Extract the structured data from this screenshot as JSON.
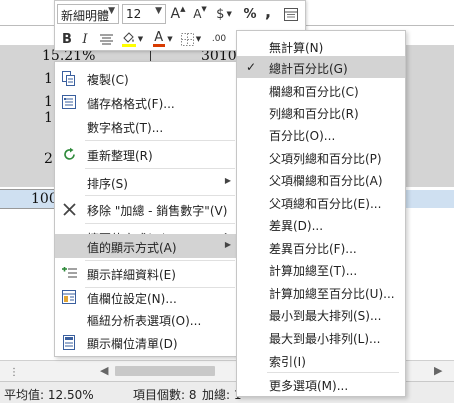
{
  "colors": {
    "accent_font_red": "#d83b01",
    "fill_yellow": "#ffff00",
    "cell_gray": "#d4d4d4",
    "cell_blue": "#cfe0f1",
    "menu_highlight": "#d3d3d3"
  },
  "toolbar": {
    "font_name": "新細明體",
    "font_size": "12",
    "grow_font": "A",
    "shrink_font": "A",
    "currency": "$",
    "percent": "%",
    "comma": ",",
    "bold": "B",
    "italic": "I",
    "fill_icon": "paint-bucket-icon",
    "font_color_letter": "A",
    "borders_icon": "borders-icon",
    "format_table_icon": "format-table-icon",
    "decrease_decimal_label": ".00"
  },
  "sheet": {
    "percent_value": "15.21%",
    "number_value": "3010",
    "left_fragments": [
      "1",
      "1",
      "1",
      "2"
    ],
    "blue_row_fragment": "100"
  },
  "context_menu": {
    "items": [
      {
        "icon": "copy-icon",
        "label": "複製(C)"
      },
      {
        "icon": "format-cells-icon",
        "label": "儲存格格式(F)..."
      },
      {
        "icon": "",
        "label": "數字格式(T)..."
      },
      {
        "icon": "refresh-icon",
        "label": "重新整理(R)"
      },
      {
        "icon": "",
        "label": "排序(S)"
      },
      {
        "icon": "remove-icon",
        "label": "移除 \"加總 - 銷售數字\"(V)"
      },
      {
        "icon": "",
        "label": "摘要值方式(M)"
      },
      {
        "icon": "",
        "label": "值的顯示方式(A)"
      },
      {
        "icon": "show-details-icon",
        "label": "顯示詳細資料(E)"
      },
      {
        "icon": "field-settings-icon",
        "label": "值欄位設定(N)..."
      },
      {
        "icon": "",
        "label": "樞紐分析表選項(O)..."
      },
      {
        "icon": "field-list-icon",
        "label": "顯示欄位清單(D)"
      }
    ]
  },
  "submenu": {
    "items": [
      "無計算(N)",
      "總計百分比(G)",
      "欄總和百分比(C)",
      "列總和百分比(R)",
      "百分比(O)...",
      "父項列總和百分比(P)",
      "父項欄總和百分比(A)",
      "父項總和百分比(E)...",
      "差異(D)...",
      "差異百分比(F)...",
      "計算加總至(T)...",
      "計算加總至百分比(U)...",
      "最小到最大排列(S)...",
      "最大到最小排列(L)...",
      "索引(I)",
      "更多選項(M)..."
    ],
    "check_icon": "checkmark-icon"
  },
  "status_bar": {
    "average": "平均值: 12.50%",
    "count": "項目個數: 8",
    "sum": "加總: 1"
  }
}
